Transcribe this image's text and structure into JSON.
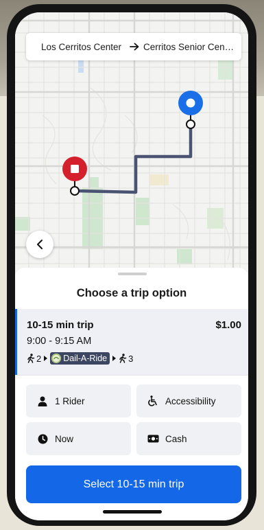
{
  "route": {
    "origin": "Los Cerritos Center",
    "destination": "Cerritos Senior Cent..."
  },
  "icons": {
    "route_arrow": "arrow-right-icon",
    "back": "chevron-left-icon",
    "origin_marker": "blue-dot-marker-icon",
    "destination_marker": "red-square-marker-icon",
    "rider": "person-icon",
    "accessibility": "wheelchair-icon",
    "time": "clock-icon",
    "payment": "cash-icon",
    "walk": "walking-person-icon"
  },
  "sheet": {
    "title": "Choose a trip option"
  },
  "trip": {
    "name": "10-15 min trip",
    "price": "$1.00",
    "time": "9:00 - 9:15 AM",
    "walk_before": "2",
    "agency": "Dail-A-Ride",
    "walk_after": "3"
  },
  "options": {
    "riders": "1 Rider",
    "accessibility": "Accessibility",
    "when": "Now",
    "payment": "Cash"
  },
  "action": {
    "select_label": "Select 10-15 min trip"
  },
  "colors": {
    "accent": "#1467e6",
    "route_line": "#4a5372",
    "origin_marker": "#1a6fe8",
    "destination_marker": "#d4202c",
    "agency_badge": "#3c4660"
  }
}
